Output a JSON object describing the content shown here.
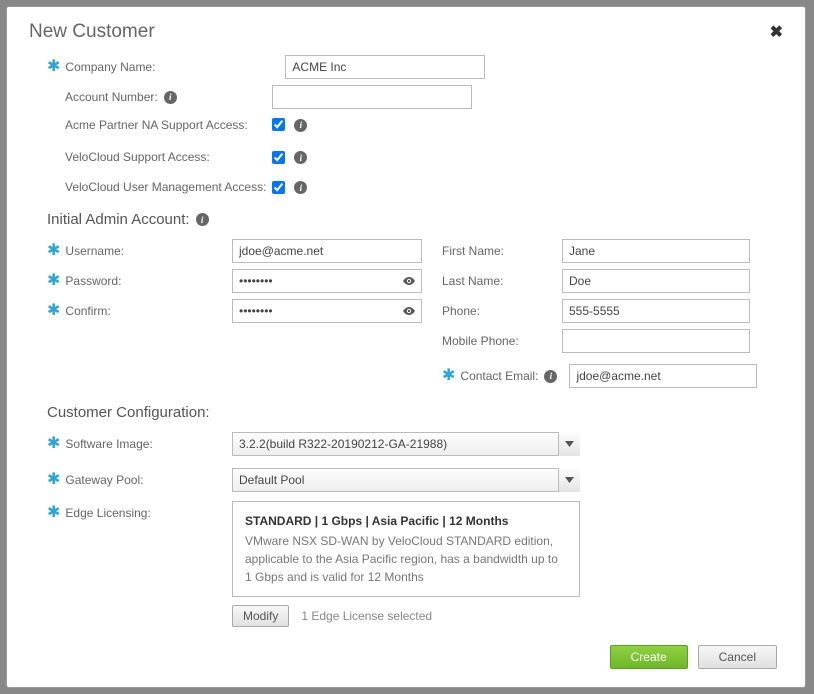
{
  "dialog": {
    "title": "New Customer"
  },
  "company": {
    "company_name_label": "Company Name:",
    "company_name_value": "ACME Inc",
    "account_number_label": "Account Number:",
    "account_number_value": "",
    "partner_support_label": "Acme Partner NA Support Access:",
    "partner_support_checked": true,
    "vc_support_label": "VeloCloud Support Access:",
    "vc_support_checked": true,
    "vc_usermgmt_label": "VeloCloud User Management Access:",
    "vc_usermgmt_checked": true
  },
  "admin": {
    "section_title": "Initial Admin Account:",
    "username_label": "Username:",
    "username_value": "jdoe@acme.net",
    "password_label": "Password:",
    "password_value": "••••••••",
    "confirm_label": "Confirm:",
    "confirm_value": "••••••••",
    "first_name_label": "First Name:",
    "first_name_value": "Jane",
    "last_name_label": "Last Name:",
    "last_name_value": "Doe",
    "phone_label": "Phone:",
    "phone_value": "555-5555",
    "mobile_label": "Mobile Phone:",
    "mobile_value": "",
    "contact_email_label": "Contact Email:",
    "contact_email_value": "jdoe@acme.net"
  },
  "config": {
    "section_title": "Customer Configuration:",
    "software_image_label": "Software Image:",
    "software_image_value": "3.2.2(build R322-20190212-GA-21988)",
    "gateway_pool_label": "Gateway Pool:",
    "gateway_pool_value": "Default Pool",
    "edge_licensing_label": "Edge Licensing:",
    "license": {
      "title": "STANDARD | 1 Gbps | Asia Pacific | 12 Months",
      "desc": "VMware NSX SD-WAN by VeloCloud STANDARD edition, applicable to the Asia Pacific region, has a bandwidth up to 1 Gbps and is valid for 12 Months"
    },
    "modify_label": "Modify",
    "license_count_label": "1 Edge License selected"
  },
  "footer": {
    "create": "Create",
    "cancel": "Cancel"
  }
}
